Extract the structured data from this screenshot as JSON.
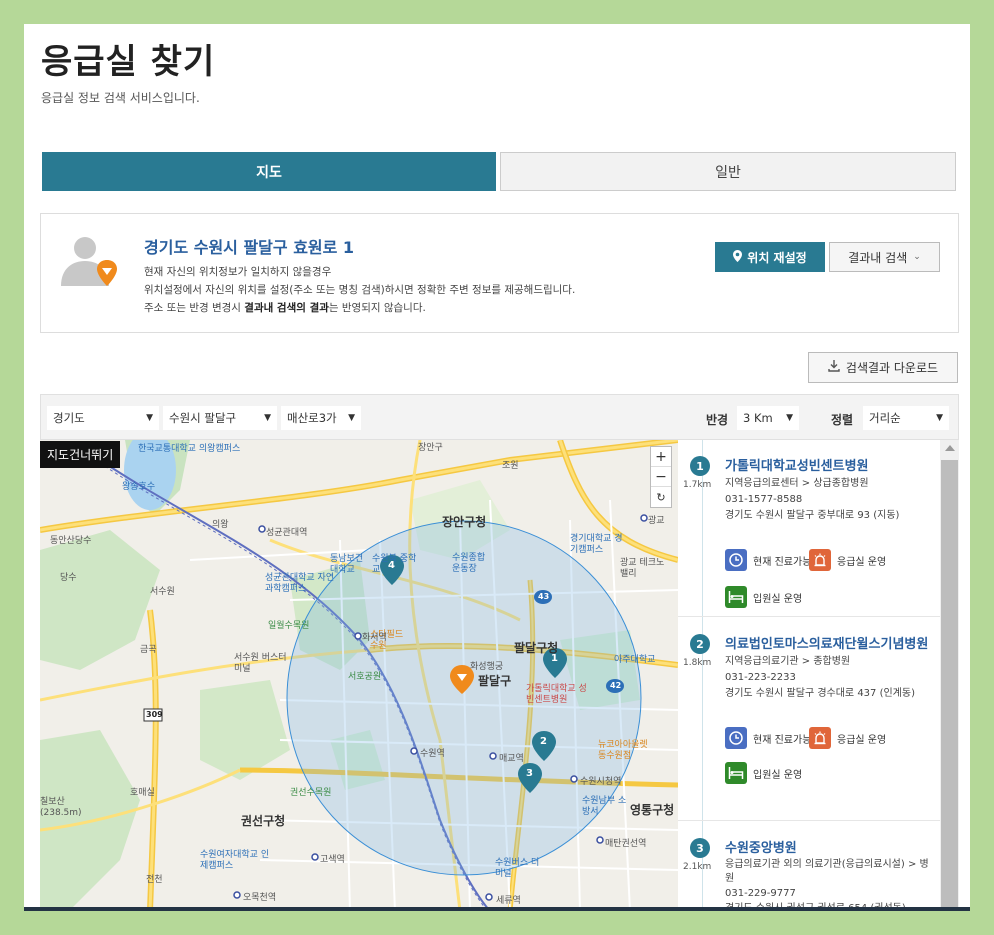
{
  "page": {
    "title": "응급실 찾기",
    "subtitle": "응급실 정보 검색 서비스입니다."
  },
  "tabs": [
    {
      "label": "지도",
      "active": true
    },
    {
      "label": "일반",
      "active": false
    }
  ],
  "location": {
    "address": "경기도 수원시 팔달구 효원로 1",
    "notes": [
      "현재 자신의 위치정보가 일치하지 않을경우",
      "위치설정에서 자신의 위치를 설정(주소 또는 명칭 검색)하시면 정확한 주변 정보를 제공해드립니다."
    ],
    "note3_pre": "주소 또는 반경 변경시 ",
    "note3_bold": "결과내 검색의 결과",
    "note3_post": "는 반영되지 않습니다.",
    "reset_button": "위치 재설정",
    "search_button": "결과내 검색"
  },
  "download_button": "검색결과 다운로드",
  "filters": {
    "province": "경기도",
    "city": "수원시 팔달구",
    "dong": "매산로3가",
    "radius_label": "반경",
    "radius_value": "3 Km",
    "sort_label": "정렬",
    "sort_value": "거리순"
  },
  "map": {
    "skip_button": "지도건너뛰기",
    "zoom_in": "+",
    "zoom_out": "−",
    "reset": "↻",
    "labels": [
      "한국교통대학교 의왕캠퍼스",
      "왕송호수",
      "동안산당수",
      "당수",
      "의왕",
      "성균관대역",
      "서수원",
      "성균관대학교 자연과학캠퍼스",
      "일월수목원",
      "금곡",
      "서수원 버스터미널",
      "동남보건 대학교",
      "수원북 중학교",
      "수원종합 운동장",
      "장안구청",
      "장안구",
      "조원",
      "경기대학교 경기캠퍼스",
      "광교",
      "광교 테크노밸리",
      "스타필드 수원",
      "화서역",
      "서호공원",
      "팔달구청",
      "화성행궁",
      "팔달구",
      "가톨릭대학교 성빈센트병원",
      "아주대학교",
      "수원역",
      "매교역",
      "뉴코아아울렛 동수원점",
      "수원시청역",
      "권선구청",
      "권선수목원",
      "호매실",
      "칠보산 (238.5m)",
      "수원여자대학교 인제캠퍼스",
      "고색역",
      "전천",
      "오목천역",
      "세류역",
      "수원남부 소방서",
      "영통구청",
      "매탄권선역",
      "수원버스 터미널",
      "43",
      "42",
      "309"
    ],
    "markers": [
      "1",
      "2",
      "3",
      "4"
    ]
  },
  "results": [
    {
      "num": "1",
      "distance": "1.7km",
      "name": "가톨릭대학교성빈센트병원",
      "type": "지역응급의료센터 > 상급종합병원",
      "phone": "031-1577-8588",
      "address": "경기도 수원시 팔달구 중부대로 93 (지동)",
      "badges": [
        "현재 진료가능",
        "응급실 운영",
        "입원실 운영"
      ]
    },
    {
      "num": "2",
      "distance": "1.8km",
      "name": "의료법인토마스의료재단윌스기념병원",
      "type": "지역응급의료기관 > 종합병원",
      "phone": "031-223-2233",
      "address": "경기도 수원시 팔달구 경수대로 437 (인계동)",
      "badges": [
        "현재 진료가능",
        "응급실 운영",
        "입원실 운영"
      ]
    },
    {
      "num": "3",
      "distance": "2.1km",
      "name": "수원중앙병원",
      "type": "응급의료기관 외의 의료기관(응급의료시설) > 병원",
      "phone": "031-229-9777",
      "address": "경기도 수원시 권선구 권선로 654 (권선동)"
    }
  ],
  "colors": {
    "accent": "#297a92",
    "background": "#b5d898",
    "title_blue": "#2a5f9e",
    "badge_clock": "#4a6ec2",
    "badge_alarm": "#e0663a",
    "badge_bed": "#2f8a2a"
  }
}
